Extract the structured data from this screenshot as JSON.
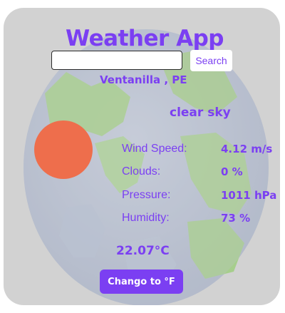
{
  "app": {
    "title": "Weather App"
  },
  "search": {
    "value": "",
    "placeholder": "",
    "button_label": "Search"
  },
  "weather": {
    "location": "Ventanilla , PE",
    "description": "clear sky",
    "icon": "sun-icon",
    "temperature": "22.07°C"
  },
  "stats": [
    {
      "label": "Wind Speed:",
      "value": "4.12 m/s"
    },
    {
      "label": "Clouds:",
      "value": "0 %"
    },
    {
      "label": "Pressure:",
      "value": "1011 hPa"
    },
    {
      "label": "Humidity:",
      "value": "73 %"
    }
  ],
  "unit_toggle": {
    "label": "Chango to °F"
  },
  "colors": {
    "accent": "#7b3ff2",
    "card": "#d2d2d2",
    "sun": "#ee6e4c",
    "ocean": "#b9c3d6",
    "land": "#9dcc7c"
  }
}
